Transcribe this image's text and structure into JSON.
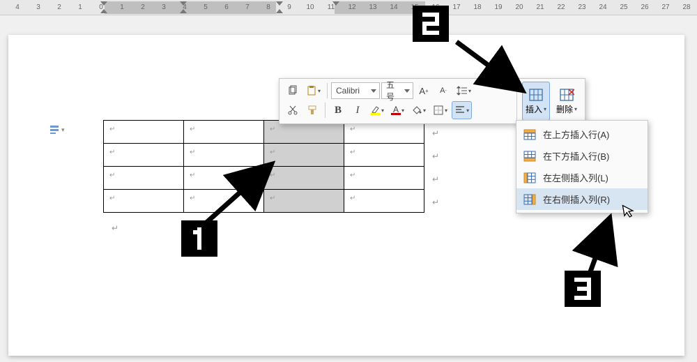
{
  "ruler": {
    "start": -4,
    "end": 31
  },
  "toolbar": {
    "font_name": "Calibri",
    "font_size": "五号",
    "grow_font": "A⁺",
    "shrink_font": "A⁻",
    "bold": "B",
    "italic": "I",
    "insert_label": "插入",
    "delete_label": "删除"
  },
  "dropdown": {
    "items": [
      {
        "label": "在上方插入行(A)",
        "icon": "insert-row-above"
      },
      {
        "label": "在下方插入行(B)",
        "icon": "insert-row-below"
      },
      {
        "label": "在左侧插入列(L)",
        "icon": "insert-col-left"
      },
      {
        "label": "在右侧插入列(R)",
        "icon": "insert-col-right"
      }
    ]
  },
  "markers": {
    "one": "1",
    "two": "2",
    "three": "3"
  }
}
